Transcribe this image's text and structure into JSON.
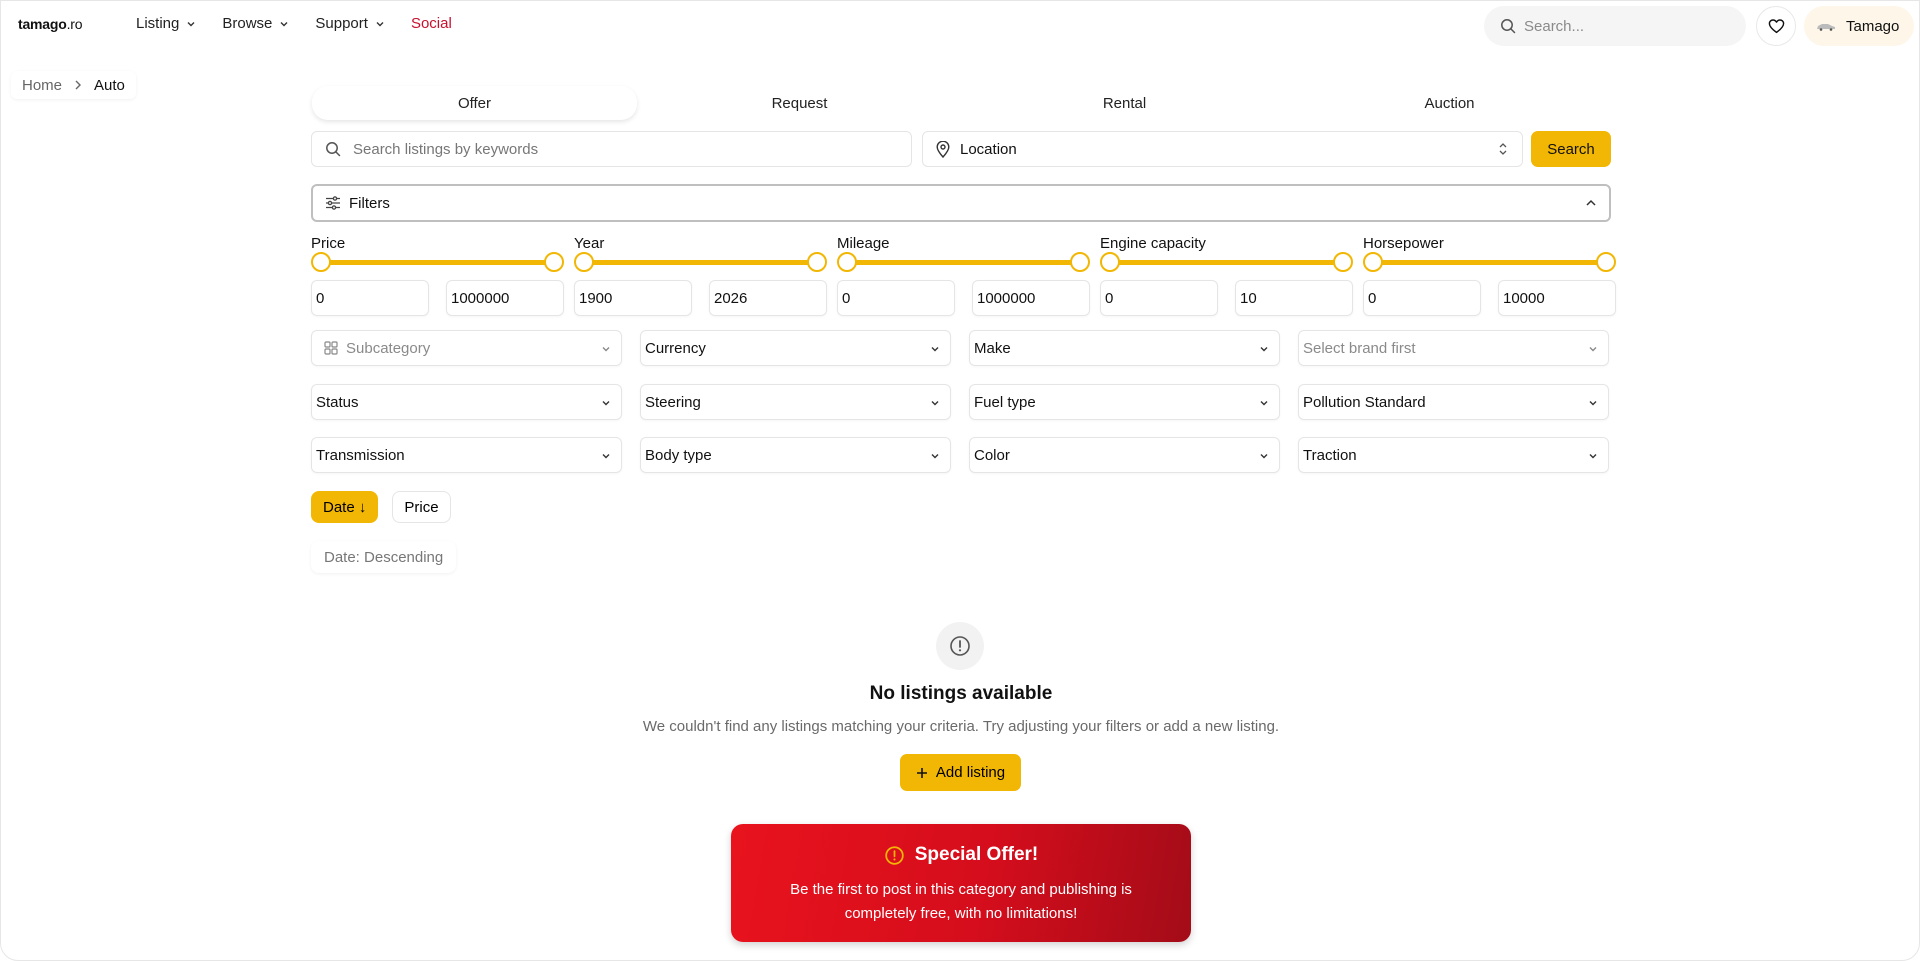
{
  "header": {
    "logo_main": "tamago",
    "logo_tld": ".ro",
    "nav": [
      {
        "label": "Listing"
      },
      {
        "label": "Browse"
      },
      {
        "label": "Support"
      },
      {
        "label": "Social"
      }
    ],
    "search_placeholder": "Search...",
    "user_name": "Tamago"
  },
  "breadcrumb": {
    "home": "Home",
    "current": "Auto"
  },
  "tabs": [
    "Offer",
    "Request",
    "Rental",
    "Auction"
  ],
  "search": {
    "keywords_placeholder": "Search listings by keywords",
    "location_label": "Location",
    "button_label": "Search"
  },
  "filters": {
    "title": "Filters",
    "ranges": [
      {
        "label": "Price",
        "min": "0",
        "max": "1000000"
      },
      {
        "label": "Year",
        "min": "1900",
        "max": "2026"
      },
      {
        "label": "Mileage",
        "min": "0",
        "max": "1000000"
      },
      {
        "label": "Engine capacity",
        "min": "0",
        "max": "10"
      },
      {
        "label": "Horsepower",
        "min": "0",
        "max": "10000"
      }
    ],
    "dropdowns": [
      {
        "label": "Subcategory"
      },
      {
        "label": "Currency"
      },
      {
        "label": "Make"
      },
      {
        "label": "Select brand first"
      },
      {
        "label": "Status"
      },
      {
        "label": "Steering"
      },
      {
        "label": "Fuel type"
      },
      {
        "label": "Pollution Standard"
      },
      {
        "label": "Transmission"
      },
      {
        "label": "Body type"
      },
      {
        "label": "Color"
      },
      {
        "label": "Traction"
      }
    ]
  },
  "sort": {
    "date_label": "Date",
    "date_arrow": "↓",
    "price_label": "Price",
    "state": "Date: Descending"
  },
  "empty": {
    "title": "No listings available",
    "subtitle": "We couldn't find any listings matching your criteria. Try adjusting your filters or add a new listing.",
    "add_label": "Add listing"
  },
  "offer": {
    "title": "Special Offer!",
    "body": "Be the first to post in this category and publishing is completely free, with no limitations!"
  },
  "colors": {
    "accent": "#f2b705",
    "social": "#c8102e",
    "offer_red": "#e8131d"
  }
}
